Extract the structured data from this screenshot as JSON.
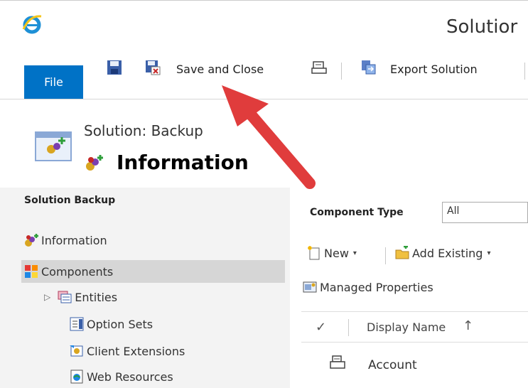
{
  "window": {
    "title": "Solutior"
  },
  "ribbon": {
    "file_label": "File",
    "save_close_label": "Save and Close",
    "export_label": "Export Solution"
  },
  "header": {
    "solution_name": "Solution: Backup",
    "section_title": "Information"
  },
  "nav": {
    "title": "Solution Backup",
    "items": [
      {
        "label": "Information",
        "icon": "information-icon"
      },
      {
        "label": "Components",
        "icon": "components-icon",
        "selected": true
      },
      {
        "label": "Entities",
        "icon": "entities-icon",
        "expander": "▷"
      },
      {
        "label": "Option Sets",
        "icon": "option-sets-icon"
      },
      {
        "label": "Client Extensions",
        "icon": "client-extensions-icon"
      },
      {
        "label": "Web Resources",
        "icon": "web-resources-icon"
      }
    ]
  },
  "main": {
    "component_type_label": "Component Type",
    "component_type_value": "All",
    "toolbar": {
      "new_label": "New",
      "add_existing_label": "Add Existing",
      "managed_properties_label": "Managed Properties"
    },
    "grid": {
      "check_symbol": "✓",
      "column_display_name": "Display Name",
      "sort_symbol": "↑",
      "rows": [
        {
          "display_name": "Account"
        }
      ]
    }
  },
  "colors": {
    "file_button": "#0072c6",
    "arrow": "#e03c3c",
    "nav_bg": "#f3f3f3",
    "nav_selected": "#d6d6d6"
  }
}
